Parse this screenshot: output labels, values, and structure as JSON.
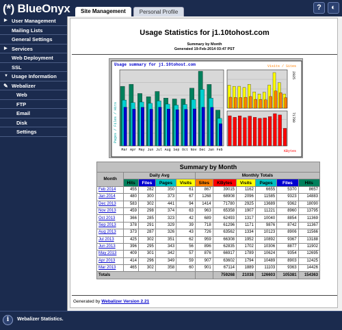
{
  "app": {
    "logo_text": "(*) BlueOnyx"
  },
  "tabs": [
    {
      "label": "Site Management",
      "active": true
    },
    {
      "label": "Personal Profile",
      "active": false
    }
  ],
  "header_buttons": {
    "help": "?",
    "logout": "◐"
  },
  "sidebar": {
    "items": [
      {
        "label": "User Management",
        "level": 0
      },
      {
        "label": "Mailing Lists",
        "level": 1
      },
      {
        "label": "General Settings",
        "level": 1
      },
      {
        "label": "Services",
        "level": 0
      },
      {
        "label": "Web Deployment",
        "level": 1
      },
      {
        "label": "SSL",
        "level": 1
      },
      {
        "label": "Usage Information",
        "level": 0
      },
      {
        "label": "Webalizer",
        "level": 1
      },
      {
        "label": "Web",
        "level": 2
      },
      {
        "label": "FTP",
        "level": 2
      },
      {
        "label": "Email",
        "level": 2
      },
      {
        "label": "Disk",
        "level": 2
      },
      {
        "label": "Settings",
        "level": 2
      }
    ]
  },
  "page": {
    "title": "Usage Statistics for j1.10tohost.com",
    "subtitle_line1": "Summary by Month",
    "subtitle_line2": "Generated 19-Feb-2014 03:47 PST"
  },
  "chart_data": {
    "type": "bar",
    "title": "Usage summary for j1.10tohost.com",
    "categories": [
      "Mar",
      "Apr",
      "May",
      "Jun",
      "Jul",
      "Aug",
      "Sep",
      "Oct",
      "Nov",
      "Dec",
      "Jan",
      "Feb"
    ],
    "y_left_label": "Pages / Files / Hits",
    "y_left_max": 2835,
    "y_right_top_max": 2925,
    "y_right_bottom_max": 71780,
    "right_top_label": "Visits / Sites",
    "right_bottom_label": "KBytes",
    "series": [
      {
        "name": "Hits",
        "color": "#00805c",
        "values": [
          14426,
          14923,
          12695,
          11902,
          13188,
          11566,
          11367,
          11369,
          13983,
          18090,
          14883,
          8657
        ]
      },
      {
        "name": "Files",
        "color": "#0000d0",
        "values": [
          9363,
          8903,
          9354,
          8877,
          9367,
          8906,
          8742,
          8854,
          8960,
          9362,
          9323,
          5370
        ]
      },
      {
        "name": "Pages",
        "color": "#00c0c0",
        "values": [
          11103,
          10489,
          10624,
          10306,
          10892,
          10123,
          9876,
          10040,
          11221,
          13689,
          11585,
          6655
        ]
      },
      {
        "name": "Visits",
        "color": "#ffff00",
        "values": [
          1889,
          1794,
          1798,
          1702,
          1952,
          1334,
          1171,
          1317,
          1907,
          2925,
          2096,
          1162
        ]
      },
      {
        "name": "Sites",
        "color": "#ff8000",
        "values": [
          901,
          876,
          876,
          896,
          959,
          726,
          718,
          689,
          963,
          1414,
          1268,
          867
        ]
      },
      {
        "name": "KBytes",
        "color": "#ff0000",
        "values": [
          67114,
          63602,
          66917,
          62835,
          66308,
          63562,
          61296,
          62493,
          65358,
          71780,
          68908,
          39015
        ]
      }
    ]
  },
  "table": {
    "title": "Summary by Month",
    "group_daily": "Daily Avg",
    "group_monthly": "Monthly Totals",
    "col_month": "Month",
    "daily_cols": [
      "Hits",
      "Files",
      "Pages",
      "Visits"
    ],
    "monthly_cols": [
      "Sites",
      "KBytes",
      "Visits",
      "Pages",
      "Files",
      "Hits"
    ],
    "rows": [
      {
        "month": "Feb 2014",
        "d": [
          "455",
          "282",
          "350",
          "61"
        ],
        "m": [
          "867",
          "39015",
          "1162",
          "6655",
          "5370",
          "8657"
        ]
      },
      {
        "month": "Jan 2014",
        "d": [
          "480",
          "300",
          "373",
          "67"
        ],
        "m": [
          "1268",
          "68908",
          "2096",
          "11585",
          "9323",
          "14883"
        ]
      },
      {
        "month": "Dec 2013",
        "d": [
          "583",
          "302",
          "441",
          "94"
        ],
        "m": [
          "1414",
          "71780",
          "2925",
          "13689",
          "9362",
          "18090"
        ]
      },
      {
        "month": "Nov 2013",
        "d": [
          "459",
          "298",
          "374",
          "63"
        ],
        "m": [
          "963",
          "65358",
          "1907",
          "11221",
          "8960",
          "13795"
        ]
      },
      {
        "month": "Oct 2013",
        "d": [
          "366",
          "285",
          "323",
          "42"
        ],
        "m": [
          "689",
          "62493",
          "1317",
          "10040",
          "8854",
          "11369"
        ]
      },
      {
        "month": "Sep 2013",
        "d": [
          "378",
          "291",
          "329",
          "39"
        ],
        "m": [
          "718",
          "61296",
          "1171",
          "9876",
          "8742",
          "11367"
        ]
      },
      {
        "month": "Aug 2013",
        "d": [
          "373",
          "287",
          "326",
          "43"
        ],
        "m": [
          "726",
          "63562",
          "1334",
          "10123",
          "8906",
          "11566"
        ]
      },
      {
        "month": "Jul 2013",
        "d": [
          "425",
          "302",
          "351",
          "62"
        ],
        "m": [
          "959",
          "66308",
          "1952",
          "10892",
          "9367",
          "13188"
        ]
      },
      {
        "month": "Jun 2013",
        "d": [
          "396",
          "295",
          "343",
          "56"
        ],
        "m": [
          "896",
          "62835",
          "1702",
          "10306",
          "8877",
          "11902"
        ]
      },
      {
        "month": "May 2013",
        "d": [
          "409",
          "301",
          "342",
          "57"
        ],
        "m": [
          "876",
          "66917",
          "1789",
          "10624",
          "9354",
          "12695"
        ]
      },
      {
        "month": "Apr 2013",
        "d": [
          "414",
          "296",
          "349",
          "59"
        ],
        "m": [
          "907",
          "63602",
          "1794",
          "10489",
          "8903",
          "12425"
        ]
      },
      {
        "month": "Mar 2013",
        "d": [
          "465",
          "302",
          "358",
          "60"
        ],
        "m": [
          "901",
          "67114",
          "1889",
          "11103",
          "9363",
          "14426"
        ]
      }
    ],
    "totals_label": "Totals",
    "totals": [
      "759268",
      "21038",
      "126603",
      "105381",
      "154363"
    ]
  },
  "footer": {
    "generated_prefix": "Generated by",
    "generated_link": "Webalizer Version 2.21"
  },
  "status": {
    "icon": "i",
    "text": "Webalizer Statistics."
  }
}
